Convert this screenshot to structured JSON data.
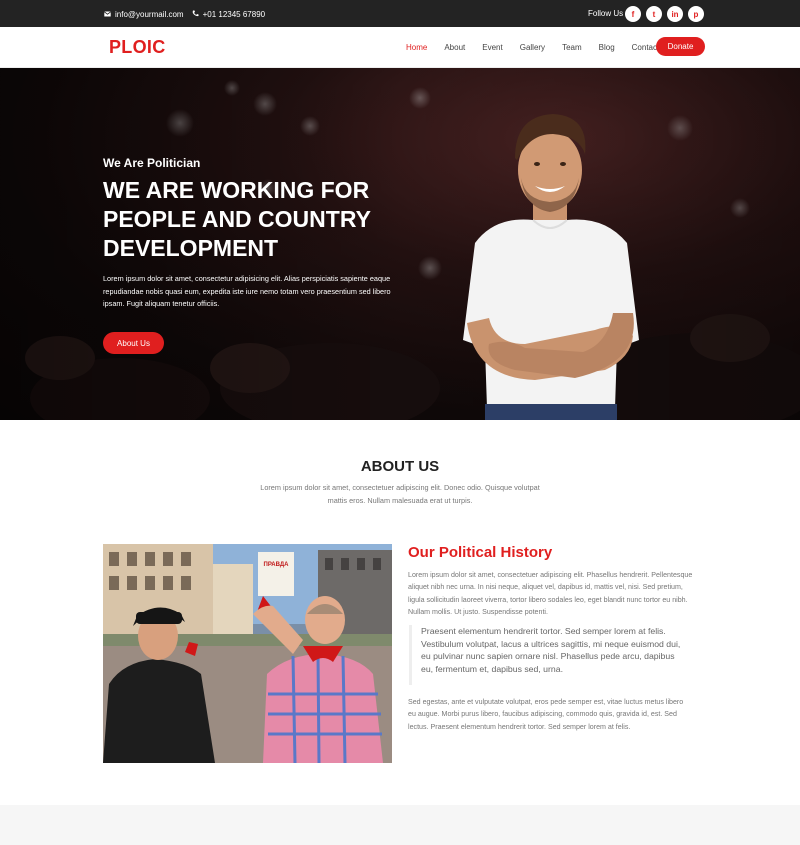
{
  "topbar": {
    "email": "info@yourmail.com",
    "phone": "+01 12345 67890",
    "follow_label": "Follow Us :",
    "socials": [
      {
        "icon": "facebook-icon",
        "glyph": "f"
      },
      {
        "icon": "twitter-icon",
        "glyph": "t"
      },
      {
        "icon": "linkedin-icon",
        "glyph": "in"
      },
      {
        "icon": "pinterest-icon",
        "glyph": "p"
      }
    ]
  },
  "header": {
    "logo": "PLOIC",
    "nav": [
      "Home",
      "About",
      "Event",
      "Gallery",
      "Team",
      "Blog",
      "Contact"
    ],
    "donate_label": "Donate"
  },
  "hero": {
    "kicker": "We Are Politician",
    "title": "WE ARE WORKING FOR PEOPLE AND COUNTRY DEVELOPMENT",
    "text": "Lorem ipsum dolor sit amet, consectetur adipisicing elit. Alias perspiciatis sapiente eaque repudiandae nobis quasi eum, expedita iste iure nemo totam vero praesentium sed libero ipsam. Fugit aliquam tenetur officiis.",
    "button_label": "About Us"
  },
  "about": {
    "title": "ABOUT US",
    "text": "Lorem ipsum dolor sit amet, consectetuer adipiscing elit. Donec odio. Quisque volutpat mattis eros. Nullam malesuada erat ut turpis."
  },
  "history": {
    "photo_sign": "ПРАВДА",
    "title": "Our Political History",
    "p1": "Lorem ipsum dolor sit amet, consectetuer adipiscing elit. Phasellus hendrerit. Pellentesque aliquet nibh nec urna. In nisi neque, aliquet vel, dapibus id, mattis vel, nisi. Sed pretium, ligula sollicitudin laoreet viverra, tortor libero sodales leo, eget blandit nunc tortor eu nibh. Nullam mollis. Ut justo. Suspendisse potenti.",
    "quote": "Praesent elementum hendrerit tortor. Sed semper lorem at felis. Vestibulum volutpat, lacus a ultrices sagittis, mi neque euismod dui, eu pulvinar nunc sapien ornare nisl. Phasellus pede arcu, dapibus eu, fermentum et, dapibus sed, urna.",
    "p2": "Sed egestas, ante et vulputate volutpat, eros pede semper est, vitae luctus metus libero eu augue. Morbi purus libero, faucibus adipiscing, commodo quis, gravida id, est. Sed lectus. Praesent elementum hendrerit tortor. Sed semper lorem at felis."
  },
  "colors": {
    "accent": "#e01f1f",
    "topbar": "#232323"
  }
}
